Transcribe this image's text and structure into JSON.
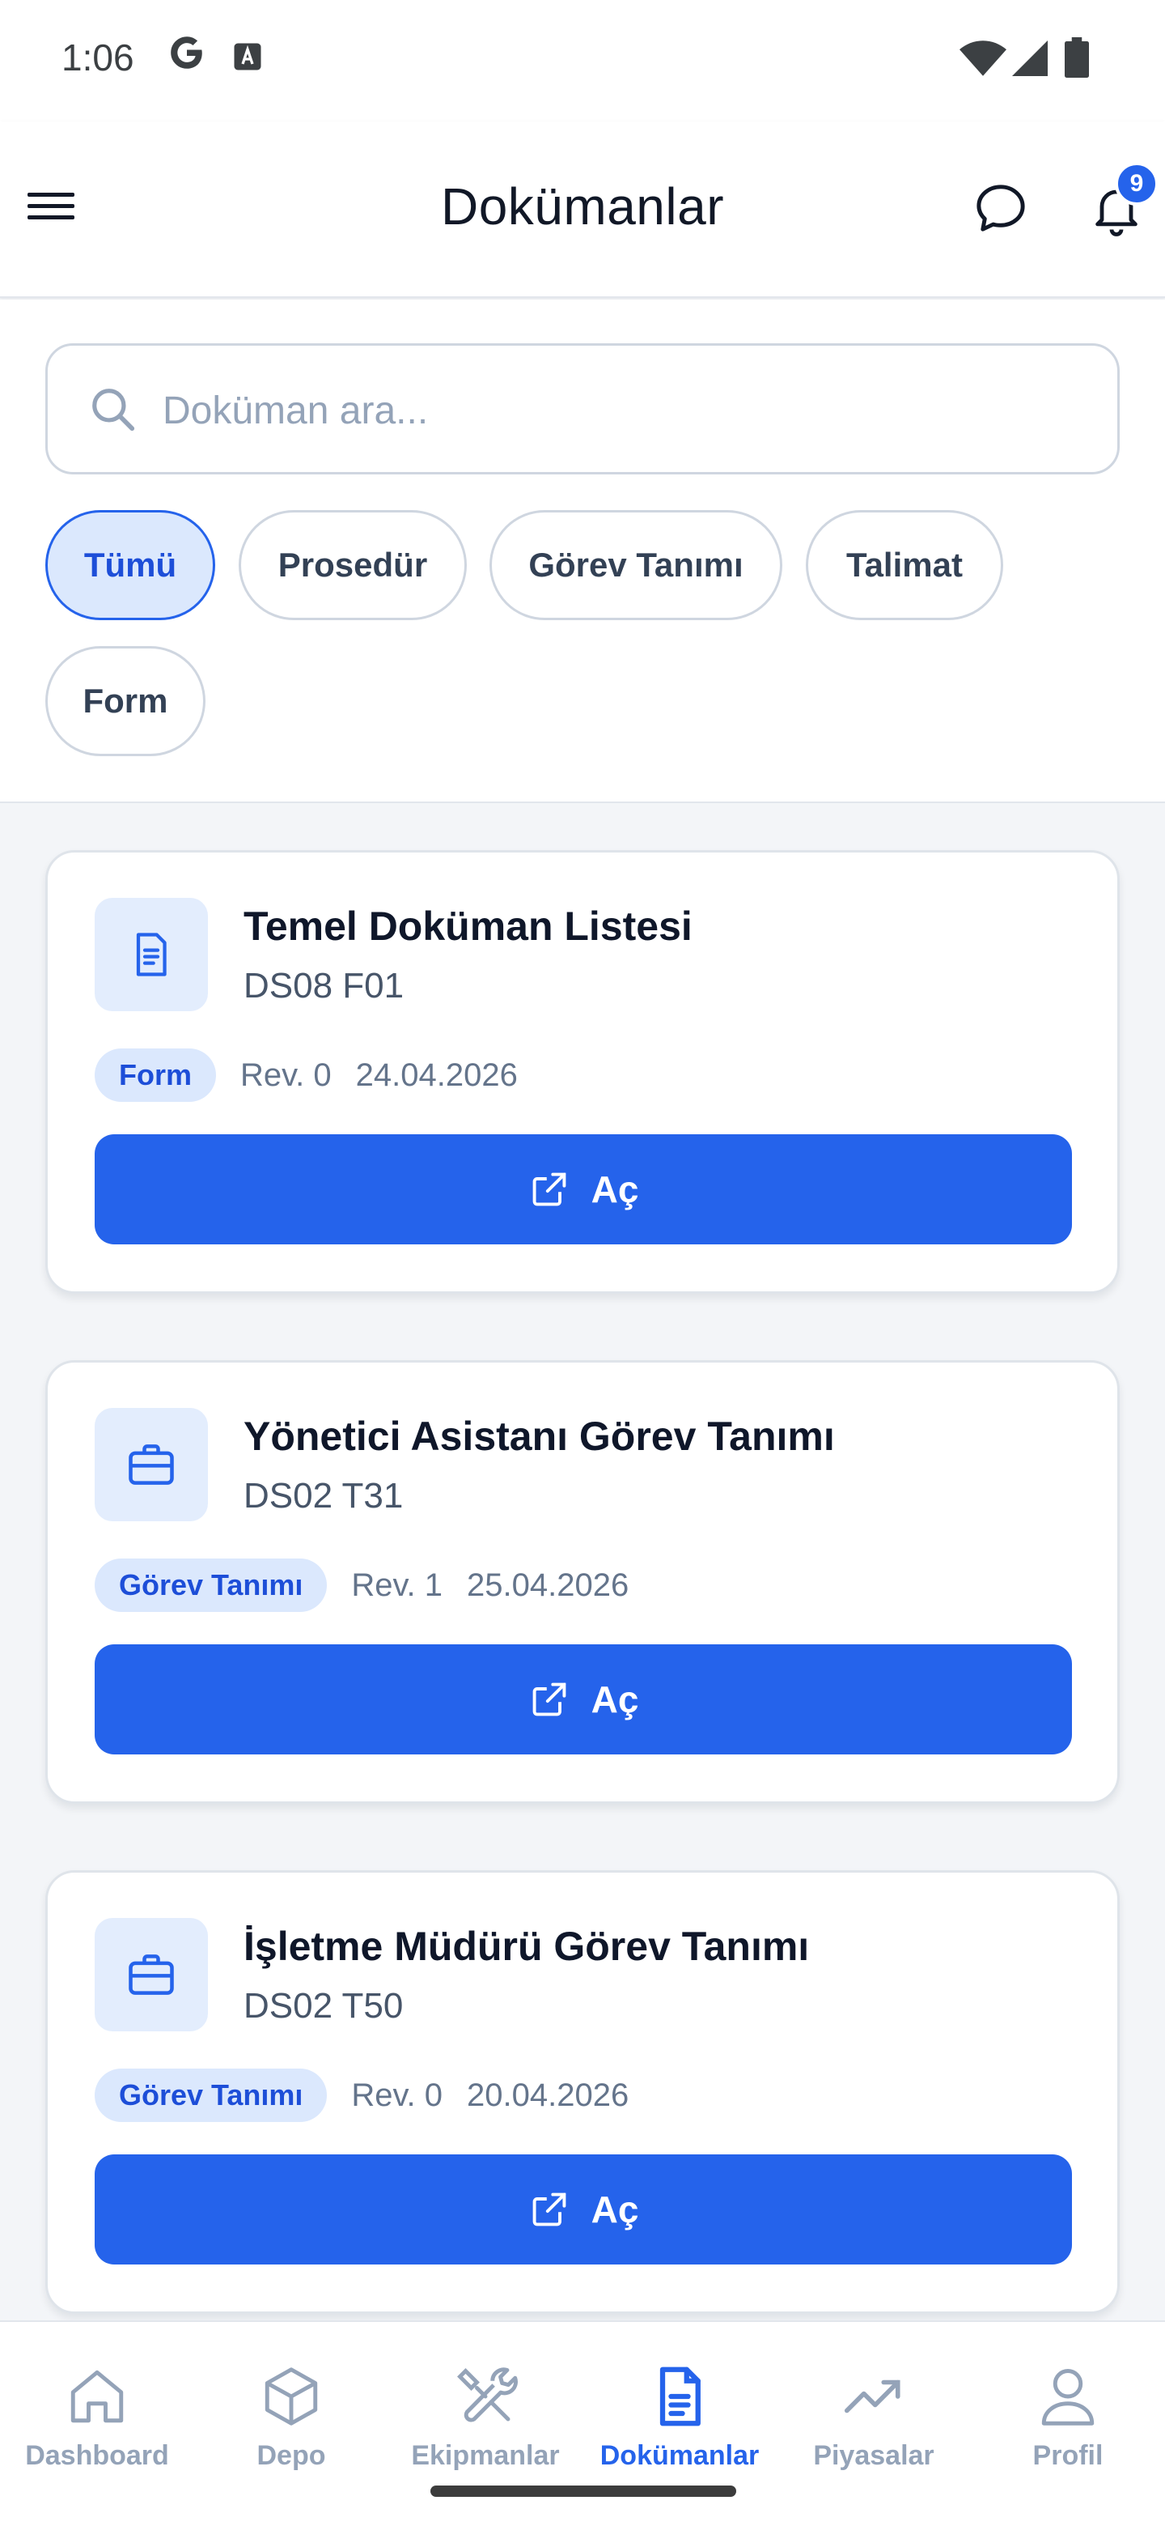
{
  "status_bar": {
    "time": "1:06",
    "icons": [
      "google-g-icon",
      "accessibility-a-icon",
      "wifi-icon",
      "cell-signal-icon",
      "battery-icon"
    ]
  },
  "header": {
    "title": "Dokümanlar",
    "menu_icon": "hamburger-menu-icon",
    "chat_icon": "chat-bubble-icon",
    "notification_icon": "bell-icon",
    "notification_count": "9"
  },
  "search": {
    "placeholder": "Doküman ara...",
    "value": ""
  },
  "filters": [
    {
      "label": "Tümü",
      "active": true
    },
    {
      "label": "Prosedür",
      "active": false
    },
    {
      "label": "Görev Tanımı",
      "active": false
    },
    {
      "label": "Talimat",
      "active": false
    },
    {
      "label": "Form",
      "active": false
    }
  ],
  "documents": [
    {
      "icon": "document-icon",
      "title": "Temel Doküman Listesi",
      "code": "DS08 F01",
      "type": "Form",
      "rev": "Rev. 0",
      "date": "24.04.2026",
      "button": "Aç"
    },
    {
      "icon": "briefcase-icon",
      "title": "Yönetici Asistanı Görev Tanımı",
      "code": "DS02 T31",
      "type": "Görev Tanımı",
      "rev": "Rev. 1",
      "date": "25.04.2026",
      "button": "Aç"
    },
    {
      "icon": "briefcase-icon",
      "title": "İşletme Müdürü Görev Tanımı",
      "code": "DS02 T50",
      "type": "Görev Tanımı",
      "rev": "Rev. 0",
      "date": "20.04.2026",
      "button": "Aç"
    }
  ],
  "bottom_nav": [
    {
      "label": "Dashboard",
      "icon": "home-icon",
      "active": false
    },
    {
      "label": "Depo",
      "icon": "cube-icon",
      "active": false
    },
    {
      "label": "Ekipmanlar",
      "icon": "tools-icon",
      "active": false
    },
    {
      "label": "Dokümanlar",
      "icon": "document-icon",
      "active": true
    },
    {
      "label": "Piyasalar",
      "icon": "trending-up-icon",
      "active": false
    },
    {
      "label": "Profil",
      "icon": "user-icon",
      "active": false
    }
  ],
  "colors": {
    "accent": "#2563eb",
    "accent_light": "#dbe8fd",
    "muted": "#94a3b8"
  }
}
